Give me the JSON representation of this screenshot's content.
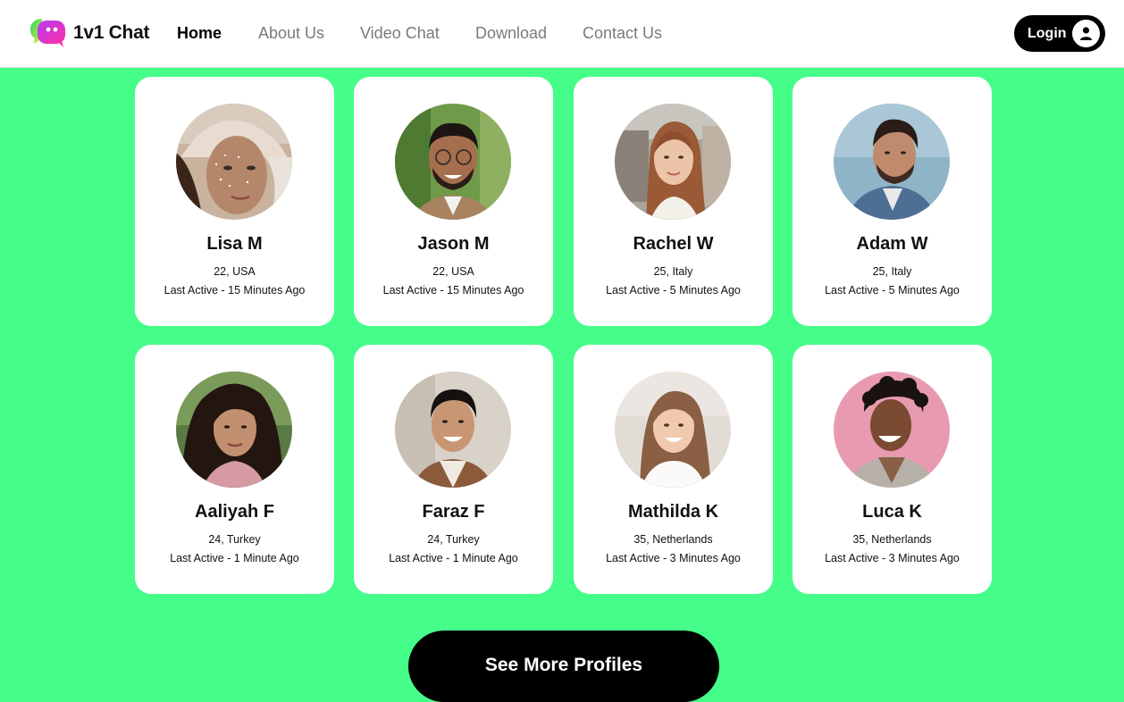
{
  "brand": {
    "name": "1v1 Chat",
    "logo_icon": "chat-bubbles-logo-icon"
  },
  "nav": {
    "items": [
      {
        "label": "Home",
        "active": true
      },
      {
        "label": "About Us",
        "active": false
      },
      {
        "label": "Video Chat",
        "active": false
      },
      {
        "label": "Download",
        "active": false
      },
      {
        "label": "Contact Us",
        "active": false
      }
    ],
    "login_label": "Login",
    "login_icon": "user-icon"
  },
  "profiles": [
    {
      "name": "Lisa M",
      "info": "22, USA",
      "active": "Last Active - 15 Minutes Ago"
    },
    {
      "name": "Jason M",
      "info": "22, USA",
      "active": "Last Active - 15 Minutes Ago"
    },
    {
      "name": "Rachel W",
      "info": "25, Italy",
      "active": "Last Active - 5 Minutes Ago"
    },
    {
      "name": "Adam W",
      "info": "25, Italy",
      "active": "Last Active - 5 Minutes Ago"
    },
    {
      "name": "Aaliyah F",
      "info": "24, Turkey",
      "active": "Last Active - 1 Minute Ago"
    },
    {
      "name": "Faraz F",
      "info": "24, Turkey",
      "active": "Last Active - 1 Minute Ago"
    },
    {
      "name": "Mathilda K",
      "info": "35, Netherlands",
      "active": "Last Active - 3 Minutes Ago"
    },
    {
      "name": "Luca K",
      "info": "35, Netherlands",
      "active": "Last Active - 3 Minutes Ago"
    }
  ],
  "cta": {
    "label": "See More Profiles"
  },
  "colors": {
    "page_bg": "#45fd89",
    "accent_black": "#000000",
    "card_bg": "#ffffff"
  }
}
